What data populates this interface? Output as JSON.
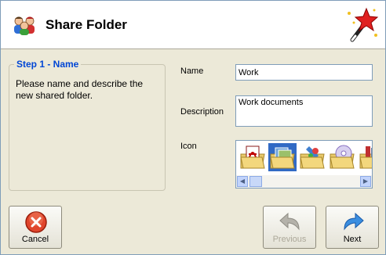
{
  "header": {
    "title": "Share Folder",
    "icon": "users-share-icon",
    "wizard_icon": "magic-wand-icon"
  },
  "step": {
    "title": "Step 1 - Name",
    "description": "Please name and describe the new shared folder."
  },
  "form": {
    "name_label": "Name",
    "name_value": "Work",
    "description_label": "Description",
    "description_value": "Work documents",
    "icon_label": "Icon",
    "icons": [
      "folder-acrobat-icon",
      "folder-photos-icon",
      "folder-paint-icon",
      "folder-disc-icon",
      "folder-tools-icon"
    ],
    "selected_icon": 1
  },
  "buttons": {
    "cancel": "Cancel",
    "previous": "Previous",
    "next": "Next"
  },
  "colors": {
    "step_title": "#0046d5",
    "selection": "#316ac5",
    "background": "#ece9d8"
  }
}
